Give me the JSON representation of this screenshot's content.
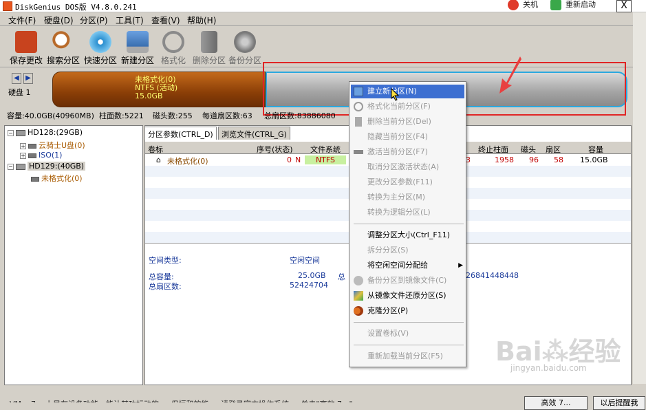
{
  "window": {
    "title": "DiskGenius DOS版 V4.8.0.241",
    "shutdown": "关机",
    "reboot": "重新启动",
    "close": "X"
  },
  "menu": [
    "文件(F)",
    "硬盘(D)",
    "分区(P)",
    "工具(T)",
    "查看(V)",
    "帮助(H)"
  ],
  "toolbar": [
    {
      "label": "保存更改",
      "icon": "save-icon",
      "color": "#c8431e"
    },
    {
      "label": "搜索分区",
      "icon": "magnifier-icon",
      "color": "#b86a2a"
    },
    {
      "label": "快速分区",
      "icon": "disc-icon",
      "color": "#2a8fd0"
    },
    {
      "label": "新建分区",
      "icon": "computer-icon",
      "color": "#3a6fb0"
    },
    {
      "label": "格式化",
      "icon": "format-icon",
      "color": "#8a8a8a"
    },
    {
      "label": "删除分区",
      "icon": "trash-icon",
      "color": "#8a8a8a"
    },
    {
      "label": "备份分区",
      "icon": "backup-icon",
      "color": "#8a8a8a"
    }
  ],
  "diskbar": {
    "disk_label": "硬盘 1",
    "partition_name": "未格式化(0)",
    "partition_fs": "NTFS (活动)",
    "partition_size": "15.0GB"
  },
  "info": {
    "capacity": "容量:40.0GB(40960MB)",
    "cylinders": "柱面数:5221",
    "heads": "磁头数:255",
    "sectors_per_track": "每道扇区数:63",
    "total_sectors": "总扇区数:83886080"
  },
  "tree": {
    "hd128": "HD128:(29GB)",
    "hd128_child1": "云骑士U盘(0)",
    "hd128_child2": "ISO(1)",
    "hd129": "HD129:(40GB)",
    "hd129_child": "未格式化(0)"
  },
  "tabs": [
    "分区参数(CTRL_D)",
    "浏览文件(CTRL_G)"
  ],
  "columns": [
    "卷标",
    "序号(状态)",
    "文件系统",
    "终止柱面",
    "磁头",
    "扇区",
    "容量"
  ],
  "row1": {
    "label": "未格式化(0)",
    "index": "0",
    "state": "N",
    "fs": "NTFS",
    "partial": "3",
    "end_cyl": "1958",
    "head": "96",
    "sector": "58",
    "size": "15.0GB"
  },
  "detail": {
    "space_type_label": "空间类型:",
    "space_type_value": "空闲空间",
    "total_capacity_label": "总容量:",
    "total_capacity_value": "25.0GB",
    "total_sectors_label": "总扇区数:",
    "total_sectors_value": "52424704",
    "partial_label": "总",
    "partial_value": "26841448448"
  },
  "context_menu": [
    {
      "label": "建立新分区(N)",
      "icon": "new-partition-icon",
      "state": "highlighted"
    },
    {
      "label": "格式化当前分区(F)",
      "icon": "format-icon",
      "state": "disabled"
    },
    {
      "label": "删除当前分区(Del)",
      "icon": "trash-icon",
      "state": "disabled"
    },
    {
      "label": "隐藏当前分区(F4)",
      "icon": "",
      "state": "disabled"
    },
    {
      "label": "激活当前分区(F7)",
      "icon": "plug-icon",
      "state": "disabled"
    },
    {
      "label": "取消分区激活状态(A)",
      "icon": "",
      "state": "disabled"
    },
    {
      "label": "更改分区参数(F11)",
      "icon": "",
      "state": "disabled"
    },
    {
      "label": "转换为主分区(M)",
      "icon": "",
      "state": "disabled"
    },
    {
      "label": "转换为逻辑分区(L)",
      "icon": "",
      "state": "disabled"
    },
    {
      "label": "调整分区大小(Ctrl_F11)",
      "icon": "",
      "state": "enabled"
    },
    {
      "label": "拆分分区(S)",
      "icon": "",
      "state": "disabled"
    },
    {
      "label": "将空闲空间分配给",
      "icon": "",
      "state": "enabled",
      "submenu": true
    },
    {
      "label": "备份分区到镜像文件(C)",
      "icon": "backup-icon",
      "state": "disabled"
    },
    {
      "label": "从镜像文件还原分区(S)",
      "icon": "restore-icon",
      "state": "enabled"
    },
    {
      "label": "克隆分区(P)",
      "icon": "clone-icon",
      "state": "enabled"
    },
    {
      "label": "设置卷标(V)",
      "icon": "",
      "state": "disabled"
    },
    {
      "label": "重新加载当前分区(F5)",
      "icon": "",
      "state": "disabled"
    }
  ],
  "status": {
    "text": "VM... 7... 上是在设备功能，能让其功标动的 ... 但恒和的能 ... 请登录官方操作系统 ... 单击\"高效 7...\"",
    "cancel": "高效 7...",
    "help": "以后提醒我"
  },
  "watermark": {
    "brand": "Bai",
    "suffix": "经验",
    "url": "jingyan.baidu.com"
  },
  "colors": {
    "highlight": "#3d6fd1",
    "partition_orange": "#a0500e",
    "free_gray": "#a6a6a6",
    "free_border": "#2aa8e0",
    "red_frame": "#e02525",
    "ntfs_green": "#c8f0a0"
  }
}
